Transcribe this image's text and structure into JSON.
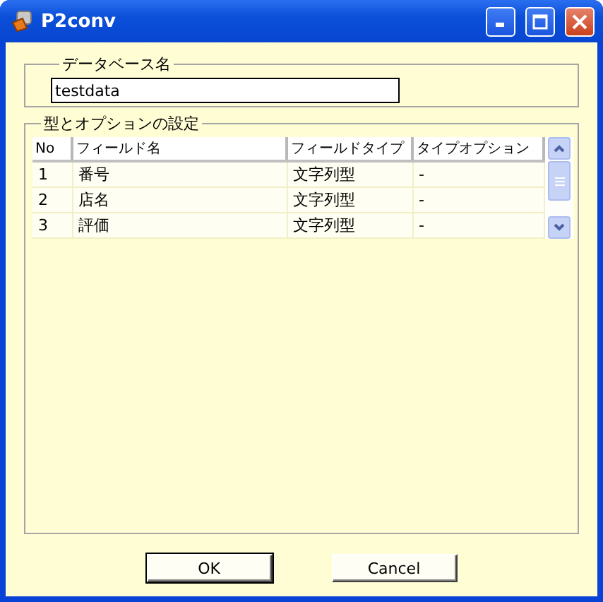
{
  "window": {
    "title": "P2conv"
  },
  "database": {
    "label": "データベース名",
    "value": "testdata"
  },
  "settings": {
    "label": "型とオプションの設定",
    "columns": [
      "No",
      "フィールド名",
      "フィールドタイプ",
      "タイプオプション"
    ],
    "rows": [
      {
        "cells": [
          "1",
          "番号",
          "文字列型",
          "-"
        ]
      },
      {
        "cells": [
          "2",
          "店名",
          "文字列型",
          "-"
        ]
      },
      {
        "cells": [
          "3",
          "評価",
          "文字列型",
          "-"
        ]
      }
    ]
  },
  "buttons": [
    "OK",
    "Cancel"
  ]
}
